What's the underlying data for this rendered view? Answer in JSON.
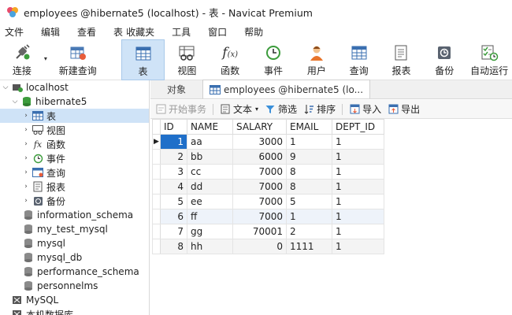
{
  "window": {
    "title": "employees @hibernate5 (localhost) - 表 - Navicat Premium"
  },
  "menu": [
    "文件",
    "编辑",
    "查看",
    "表",
    "收藏夹",
    "工具",
    "窗口",
    "帮助"
  ],
  "toolbar": {
    "connect": "连接",
    "new_query": "新建查询",
    "table": "表",
    "view": "视图",
    "function": "函数",
    "event": "事件",
    "user": "用户",
    "query": "查询",
    "report": "报表",
    "backup": "备份",
    "auto_run": "自动运行"
  },
  "tree": {
    "connection": "localhost",
    "database": "hibernate5",
    "nodes": [
      "表",
      "视图",
      "函数",
      "事件",
      "查询",
      "报表",
      "备份"
    ],
    "databases": [
      "information_schema",
      "my_test_mysql",
      "mysql",
      "mysql_db",
      "performance_schema",
      "personnelms"
    ],
    "connections": [
      "MySQL",
      "本机数据库"
    ]
  },
  "tabs": {
    "object": "对象",
    "active": "employees @hibernate5 (lo..."
  },
  "subtoolbar": {
    "begin_transaction": "开始事务",
    "text": "文本",
    "filter": "筛选",
    "sort": "排序",
    "import": "导入",
    "export": "导出"
  },
  "grid": {
    "columns": [
      "ID",
      "NAME",
      "SALARY",
      "EMAIL",
      "DEPT_ID"
    ],
    "rows": [
      [
        "1",
        "aa",
        "3000",
        "1",
        "1"
      ],
      [
        "2",
        "bb",
        "6000",
        "9",
        "1"
      ],
      [
        "3",
        "cc",
        "7000",
        "8",
        "1"
      ],
      [
        "4",
        "dd",
        "7000",
        "8",
        "1"
      ],
      [
        "5",
        "ee",
        "7000",
        "5",
        "1"
      ],
      [
        "6",
        "ff",
        "7000",
        "1",
        "1"
      ],
      [
        "7",
        "gg",
        "70001",
        "2",
        "1"
      ],
      [
        "8",
        "hh",
        "0",
        "1111",
        "1"
      ]
    ]
  },
  "colors": {
    "accent": "#1f6fc9",
    "selection": "#cfe3f7"
  }
}
